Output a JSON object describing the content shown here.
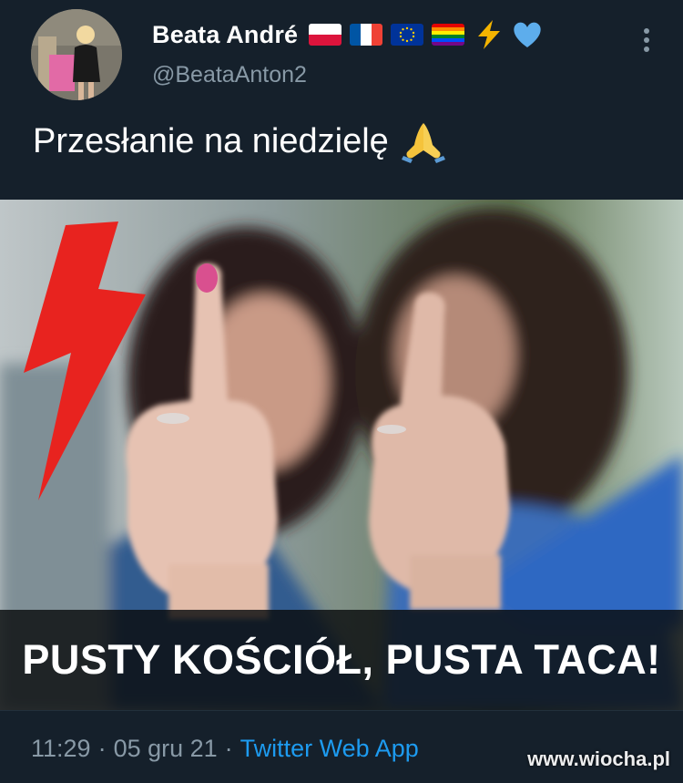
{
  "author": {
    "display_name": "Beata André",
    "handle": "@BeataAnton2",
    "badges": [
      "poland-flag-icon",
      "france-flag-icon",
      "eu-flag-icon",
      "rainbow-flag-icon",
      "lightning-icon",
      "blue-heart-icon"
    ]
  },
  "tweet": {
    "text": "Przesłanie na niedzielę",
    "text_emoji": "folded-hands-icon",
    "image_caption": "PUSTY KOŚCIÓŁ, PUSTA TACA!"
  },
  "meta": {
    "time": "11:29",
    "separator_1": "·",
    "date": "05 gru 21",
    "separator_2": "·",
    "source": "Twitter Web App"
  },
  "watermark": "www.wiocha.pl",
  "colors": {
    "background": "#15202b",
    "secondary_text": "#8899a6",
    "link": "#1d9bf0",
    "lightning_red": "#e8231f"
  }
}
